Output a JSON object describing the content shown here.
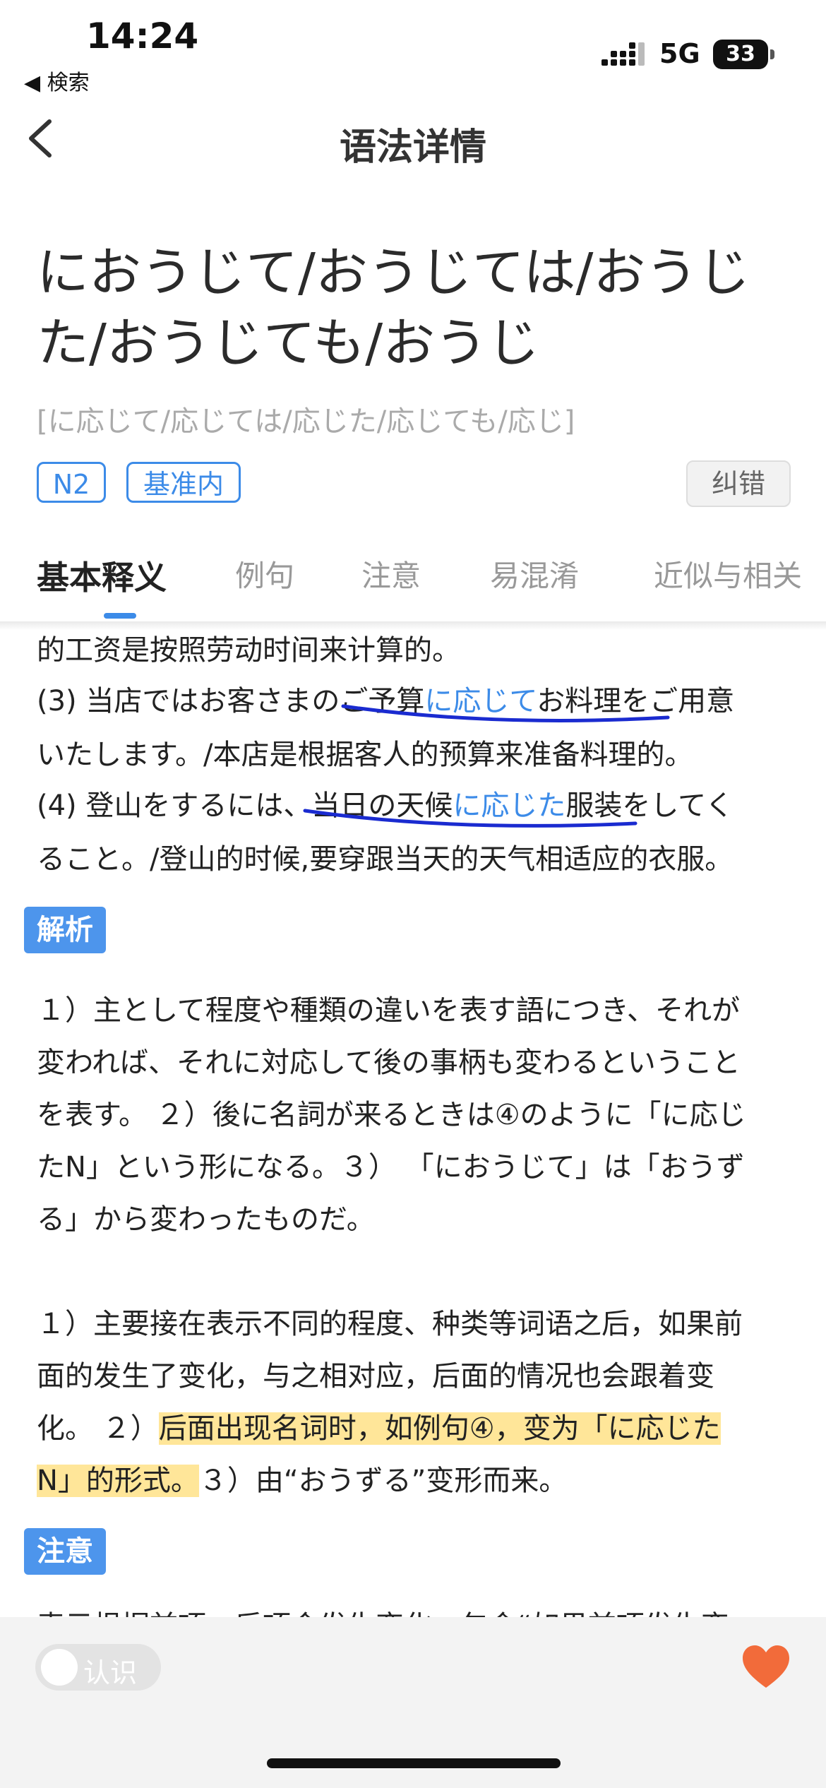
{
  "status_bar": {
    "time": "14:24",
    "back_app": "◀ 検索",
    "network": "5G",
    "battery": "33"
  },
  "nav": {
    "title": "语法详情"
  },
  "headword": {
    "line1": "におうじて/おうじては/おうじ",
    "line2": "た/おうじても/おうじ",
    "reading": "[に応じて/応じては/応じた/応じても/応じ]"
  },
  "tags": [
    "N2",
    "基准内"
  ],
  "report_button": "纠错",
  "tabs": [
    "基本释义",
    "例句",
    "注意",
    "易混淆",
    "近似与相关"
  ],
  "content": {
    "partial_line": "的工资是按照劳动时间来计算的。",
    "ex3_a": "(3) 当店ではお客さまのご予算",
    "ex3_b": "に応じて",
    "ex3_c": "お料理をご用意",
    "ex3_line2": "いたします。/本店是根据客人的预算来准备料理的。",
    "ex4_a": "(4) 登山をするには、当日の天候",
    "ex4_b": "に応じた",
    "ex4_c": "服装をしてく",
    "ex4_line2": "ること。/登山的时候,要穿跟当天的天气相适应的衣服。",
    "analysis_label": "解析",
    "jp_lines": [
      "１）主として程度や種類の違いを表す語につき、それが",
      "変われば、それに対応して後の事柄も変わるということ",
      "を表す。 ２）後に名詞が来るときは④のように「に応じ",
      "たN」という形になる。３） 「におうじて」は「おうず",
      "る」から変わったものだ。"
    ],
    "cn_line1": "１）主要接在表示不同的程度、种类等词语之后，如果前",
    "cn_line2": "面的发生了变化，与之相对应，后面的情况也会跟着变",
    "cn_line3_a": "化。 ２）",
    "cn_line3_b": "后面出现名词时，如例句④，变为「に応じた",
    "cn_line4_a": "N」的形式。",
    "cn_line4_b": "３）由“おうずる”变形而来。",
    "note_label": "注意",
    "cut_line": "表示根据前项，后项会发生变化。包含“如果前项发生变"
  },
  "bottom_bar": {
    "toggle_label": "认识"
  },
  "colors": {
    "accent": "#3c8be8",
    "heart": "#f26b3a",
    "annotation_blue": "#1a2bd0",
    "highlight_yellow": "#ffd246"
  }
}
